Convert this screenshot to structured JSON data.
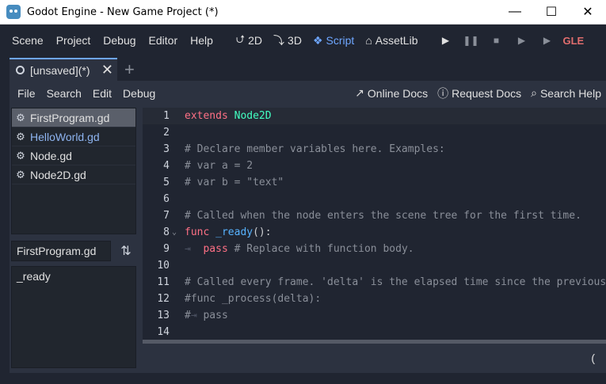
{
  "window": {
    "title": "Godot Engine - New Game Project (*)",
    "minimize": "—",
    "maximize": "☐",
    "close": "✕"
  },
  "menu": [
    "Scene",
    "Project",
    "Debug",
    "Editor",
    "Help"
  ],
  "workspaces": [
    {
      "label": "2D",
      "icon": "⮍"
    },
    {
      "label": "3D",
      "icon": "⤵"
    },
    {
      "label": "Script",
      "icon": "❖"
    },
    {
      "label": "AssetLib",
      "icon": "⌂"
    }
  ],
  "playback": {
    "play": "▶",
    "pause": "❚❚",
    "stop": "■",
    "play_scene": "▶",
    "play_custom": "▶"
  },
  "renderer": "GLE",
  "scene_tab": {
    "label": "[unsaved](*)",
    "close": "✕",
    "add": "+"
  },
  "script_menu": [
    "File",
    "Search",
    "Edit",
    "Debug"
  ],
  "help_links": [
    {
      "label": "Online Docs",
      "icon": "↗"
    },
    {
      "label": "Request Docs",
      "icon": "ⓘ"
    },
    {
      "label": "Search Help",
      "icon": "⌕"
    }
  ],
  "files": [
    {
      "name": "FirstProgram.gd",
      "selected": true
    },
    {
      "name": "HelloWorld.gd",
      "selected": false
    },
    {
      "name": "Node.gd",
      "selected": false
    },
    {
      "name": "Node2D.gd",
      "selected": false
    }
  ],
  "filter": {
    "value": "FirstProgram.gd",
    "sort_icon": "⇅"
  },
  "methods": [
    "_ready"
  ],
  "code_lines": [
    {
      "n": "1",
      "tokens": [
        {
          "t": "extends",
          "c": "kw"
        },
        {
          "t": " ",
          "c": "pl"
        },
        {
          "t": "Node2D",
          "c": "ty"
        }
      ]
    },
    {
      "n": "2",
      "tokens": []
    },
    {
      "n": "3",
      "tokens": [
        {
          "t": "# Declare member variables here. Examples:",
          "c": "cm"
        }
      ]
    },
    {
      "n": "4",
      "tokens": [
        {
          "t": "# var a = 2",
          "c": "cm"
        }
      ]
    },
    {
      "n": "5",
      "tokens": [
        {
          "t": "# var b = \"text\"",
          "c": "cm"
        }
      ]
    },
    {
      "n": "6",
      "tokens": []
    },
    {
      "n": "7",
      "tokens": [
        {
          "t": "# Called when the node enters the scene tree for the first time.",
          "c": "cm"
        }
      ]
    },
    {
      "n": "8",
      "fold": "⌄",
      "tokens": [
        {
          "t": "func",
          "c": "kw"
        },
        {
          "t": " ",
          "c": "pl"
        },
        {
          "t": "_ready",
          "c": "fn"
        },
        {
          "t": "():",
          "c": "pl"
        }
      ]
    },
    {
      "n": "9",
      "tokens": [
        {
          "t": "⇥  ",
          "c": "tabmark"
        },
        {
          "t": "pass",
          "c": "kw"
        },
        {
          "t": " ",
          "c": "pl"
        },
        {
          "t": "# Replace with function body.",
          "c": "cm"
        }
      ]
    },
    {
      "n": "10",
      "tokens": []
    },
    {
      "n": "11",
      "tokens": [
        {
          "t": "# Called every frame. 'delta' is the elapsed time since the previous frame.",
          "c": "cm"
        }
      ]
    },
    {
      "n": "12",
      "tokens": [
        {
          "t": "#func _process(delta):",
          "c": "cm"
        }
      ]
    },
    {
      "n": "13",
      "tokens": [
        {
          "t": "#",
          "c": "cm"
        },
        {
          "t": "⇥ ",
          "c": "tabmark"
        },
        {
          "t": "pass",
          "c": "cm"
        }
      ]
    },
    {
      "n": "14",
      "tokens": []
    }
  ],
  "status": {
    "position": "("
  }
}
